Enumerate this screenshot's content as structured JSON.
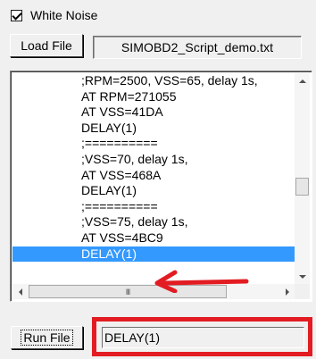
{
  "white_noise": {
    "label": "White Noise",
    "checked": true
  },
  "load_file": {
    "button_label": "Load File",
    "filename": "SIMOBD2_Script_demo.txt"
  },
  "script_list": {
    "items": [
      ";RPM=2500, VSS=65, delay 1s,",
      "AT RPM=271055",
      "AT VSS=41DA",
      "DELAY(1)",
      ";==========",
      ";VSS=70, delay 1s,",
      "AT VSS=468A",
      "DELAY(1)",
      ";==========",
      ";VSS=75, delay 1s,",
      "AT VSS=4BC9",
      "DELAY(1)"
    ],
    "selected_index": 11,
    "vertical_scroll_fraction": 0.55,
    "horizontal_scroll_thumb_glyph": "III"
  },
  "run_file": {
    "button_label": "Run File",
    "current_command": "DELAY(1)"
  },
  "annotations": {
    "highlight_color": "#e21c22",
    "selection_color": "#3399ff"
  }
}
